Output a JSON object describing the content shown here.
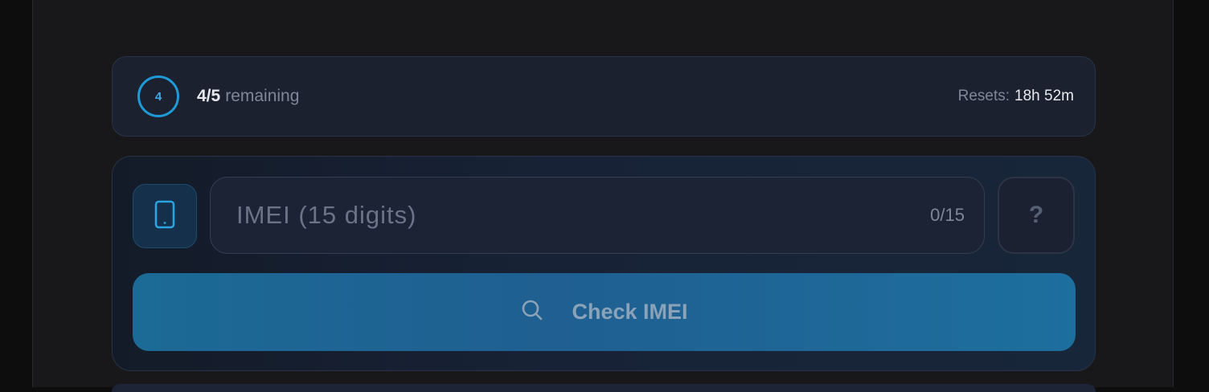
{
  "quota": {
    "ring_value": "4",
    "count": "4/5",
    "remaining_label": "remaining",
    "resets_label": "Resets:",
    "resets_value": "18h 52m"
  },
  "form": {
    "device_icon": "smartphone-icon",
    "imei_placeholder": "IMEI (15 digits)",
    "imei_value": "",
    "imei_counter": "0/15",
    "help_label": "?",
    "check_icon": "search-icon",
    "check_label": "Check IMEI"
  },
  "colors": {
    "accent": "#1e9bd7",
    "button": "#1f6694",
    "background": "#18181a"
  }
}
